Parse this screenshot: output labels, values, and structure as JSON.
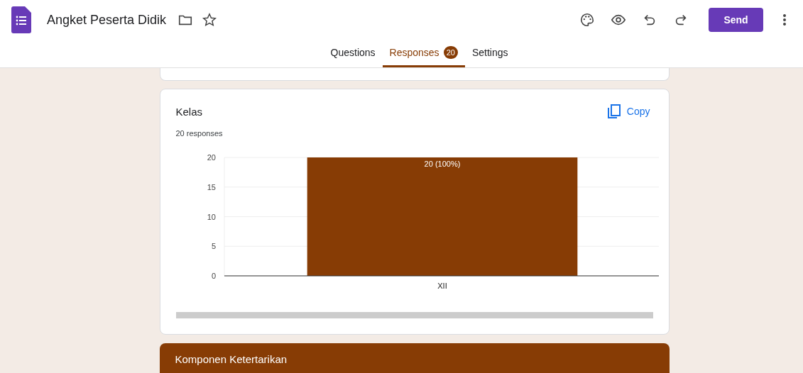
{
  "header": {
    "title": "Angket Peserta Didik",
    "send_button": "Send"
  },
  "tabs": [
    {
      "label": "Questions",
      "selected": false
    },
    {
      "label": "Responses",
      "selected": true,
      "badge": "20"
    },
    {
      "label": "Settings",
      "selected": false
    }
  ],
  "question_card": {
    "title": "Kelas",
    "copy_button": "Copy",
    "response_count": "20 responses",
    "chart_data": {
      "type": "bar",
      "categories": [
        "XII"
      ],
      "series": [
        {
          "color": "#873c05",
          "values": [
            20
          ]
        }
      ],
      "grid": true,
      "ylim": [
        0,
        20
      ],
      "yticks": [
        0,
        5,
        10,
        15,
        20
      ],
      "value_labels": [
        "20 (100%)"
      ]
    }
  },
  "section_header": {
    "title": "Komponen Ketertarikan"
  }
}
